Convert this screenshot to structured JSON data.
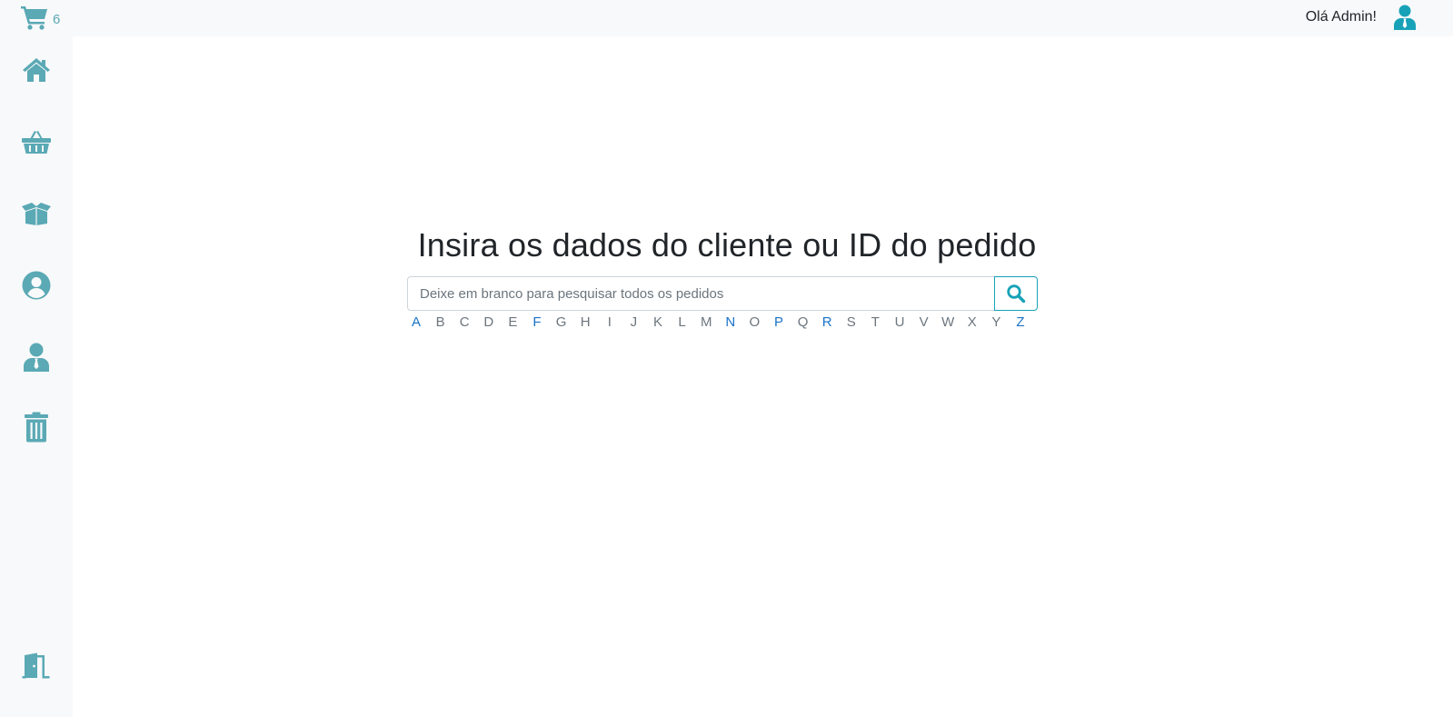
{
  "header": {
    "cart_count": "6",
    "greeting": "Olá Admin!"
  },
  "sidebar": {
    "items": [
      {
        "icon": "home-icon"
      },
      {
        "icon": "basket-icon"
      },
      {
        "icon": "box-icon"
      },
      {
        "icon": "user-circle-icon"
      },
      {
        "icon": "user-tie-icon"
      },
      {
        "icon": "trash-icon"
      }
    ],
    "logout_icon": "door-exit-icon"
  },
  "search": {
    "title": "Insira os dados do cliente ou ID do pedido",
    "placeholder": "Deixe em branco para pesquisar todos os pedidos",
    "button_icon": "search-icon"
  },
  "alphabet": {
    "letters": [
      "A",
      "B",
      "C",
      "D",
      "E",
      "F",
      "G",
      "H",
      "I",
      "J",
      "K",
      "L",
      "M",
      "N",
      "O",
      "P",
      "Q",
      "R",
      "S",
      "T",
      "U",
      "V",
      "W",
      "X",
      "Y",
      "Z"
    ],
    "active": [
      "A",
      "F",
      "N",
      "P",
      "R",
      "Z"
    ]
  },
  "colors": {
    "icon": "#5aa9b5",
    "accent_border": "#17a2b8",
    "active_letter": "#1a73c8",
    "inactive_letter": "#6c757d"
  }
}
